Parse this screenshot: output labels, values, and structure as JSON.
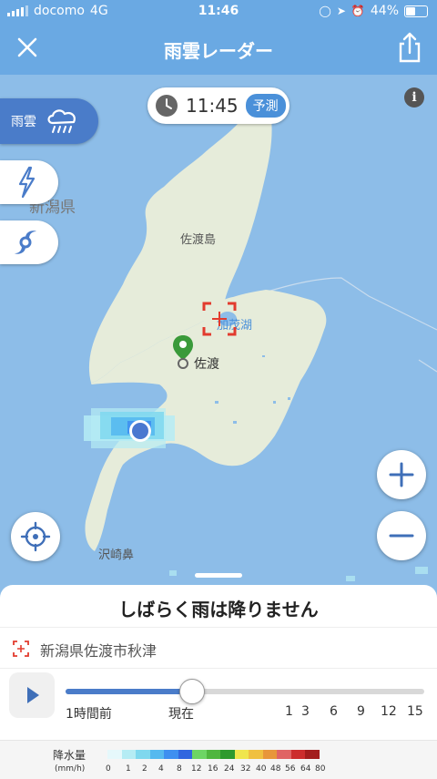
{
  "status_bar": {
    "carrier": "docomo",
    "network": "4G",
    "time": "11:46",
    "battery": "44%"
  },
  "header": {
    "title": "雨雲レーダー"
  },
  "map": {
    "time": "11:45",
    "time_badge": "予測",
    "layers": [
      {
        "label": "雨雲",
        "icon": "rain-cloud-icon",
        "active": true
      },
      {
        "label": "",
        "icon": "lightning-icon",
        "active": false
      },
      {
        "label": "",
        "icon": "typhoon-icon",
        "active": false
      }
    ],
    "labels": {
      "prefecture": "新潟県",
      "island": "佐渡島",
      "lake": "加茂湖",
      "city": "佐渡",
      "cape": "沢崎鼻"
    }
  },
  "forecast": {
    "message": "しばらく雨は降りません"
  },
  "location": {
    "address": "新潟県佐渡市秋津"
  },
  "timeline": {
    "labels": [
      "1時間前",
      "現在",
      "1",
      "3",
      "6",
      "9",
      "12",
      "15"
    ],
    "progress": 0.35
  },
  "legend": {
    "title": "降水量",
    "unit": "(mm/h)",
    "values": [
      "0",
      "1",
      "2",
      "4",
      "8",
      "12",
      "16",
      "24",
      "32",
      "40",
      "48",
      "56",
      "64",
      "80"
    ],
    "colors": [
      "#e6f8fb",
      "#b5ecf4",
      "#7fd8ee",
      "#56b9ef",
      "#3e8ff0",
      "#3166df",
      "#6dd564",
      "#4fb63e",
      "#2e9a2e",
      "#f0e64c",
      "#f0c040",
      "#e8963a",
      "#e06464",
      "#cc2d2d",
      "#a31d1d"
    ]
  }
}
